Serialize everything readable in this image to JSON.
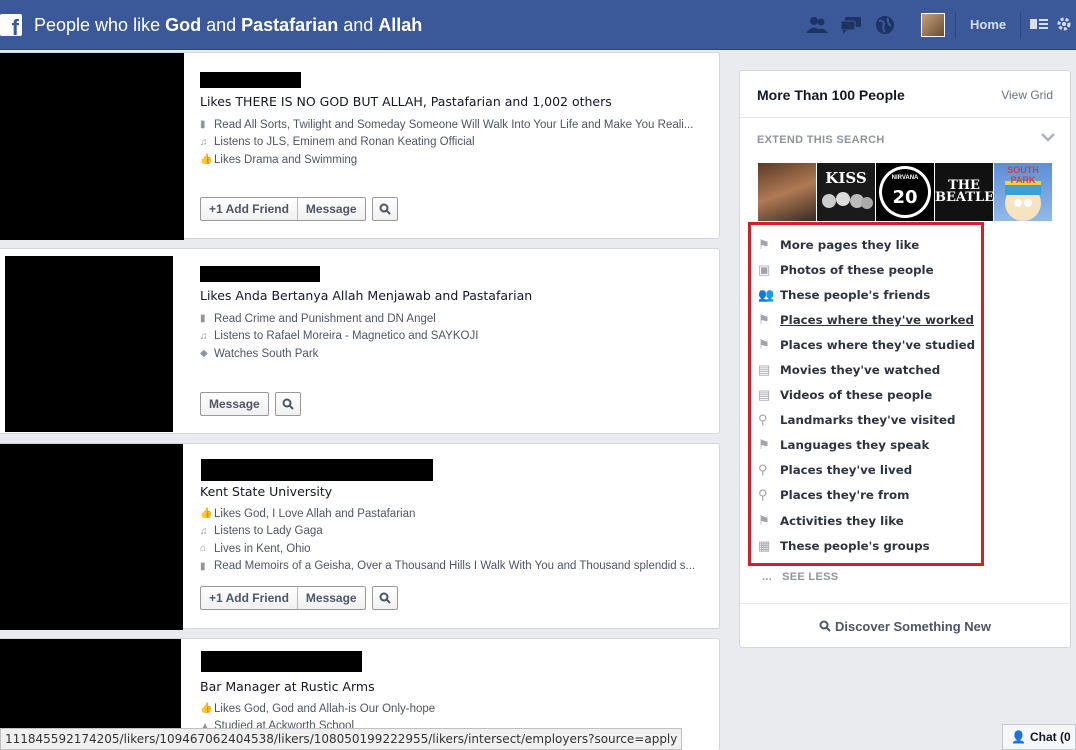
{
  "header": {
    "logo": "f",
    "search_prefix": "People who like ",
    "term1": "God",
    "and1": " and ",
    "term2": "Pastafarian",
    "and2": " and ",
    "term3": "Allah",
    "home": "Home",
    "brand_color": "#3b5998"
  },
  "results": [
    {
      "title": "Likes THERE IS NO GOD BUT ALLAH, Pastafarian and 1,002 others",
      "details": [
        {
          "icon": "book-icon",
          "text": "Read All Sorts, Twilight and Someday Someone Will Walk Into Your Life and Make You Reali..."
        },
        {
          "icon": "music-icon",
          "text": "Listens to JLS, Eminem and Ronan Keating Official"
        },
        {
          "icon": "like-icon",
          "text": "Likes Drama and Swimming"
        }
      ],
      "add_friend": "Add Friend",
      "message": "Message"
    },
    {
      "title": "Likes Anda Bertanya Allah Menjawab and Pastafarian",
      "details": [
        {
          "icon": "book-icon",
          "text": "Read Crime and Punishment and DN Angel"
        },
        {
          "icon": "music-icon",
          "text": "Listens to Rafael Moreira - Magnetico and SAYKOJI"
        },
        {
          "icon": "tag-icon",
          "text": "Watches South Park"
        }
      ],
      "message": "Message"
    },
    {
      "title": "Kent State University",
      "details": [
        {
          "icon": "like-icon",
          "text": "Likes God, I Love Allah and Pastafarian"
        },
        {
          "icon": "music-icon",
          "text": "Listens to Lady Gaga"
        },
        {
          "icon": "home-icon",
          "text": "Lives in Kent, Ohio"
        },
        {
          "icon": "book-icon",
          "text": "Read Memoirs of a Geisha, Over a Thousand Hills I Walk With You and Thousand splendid s..."
        }
      ],
      "add_friend": "Add Friend",
      "message": "Message"
    },
    {
      "title": "Bar Manager at Rustic Arms",
      "details": [
        {
          "icon": "like-icon",
          "text": "Likes God, God and Allah-is Our Only-hope"
        },
        {
          "icon": "graduation-icon",
          "text": "Studied at Ackworth School"
        }
      ]
    }
  ],
  "sidebar": {
    "title": "More Than 100 People",
    "view_grid": "View Grid",
    "extend": "EXTEND THIS SEARCH",
    "thumbs": [
      "",
      "KISS",
      "NIRVANA",
      "THE BEATLES",
      "SOUTH PARK"
    ],
    "items": [
      {
        "icon": "flag-icon",
        "label": "More pages they like"
      },
      {
        "icon": "photo-icon",
        "label": "Photos of these people"
      },
      {
        "icon": "friends-icon",
        "label": "These people's friends"
      },
      {
        "icon": "flag-icon",
        "label": "Places where they've worked"
      },
      {
        "icon": "flag-icon",
        "label": "Places where they've studied"
      },
      {
        "icon": "film-icon",
        "label": "Movies they've watched"
      },
      {
        "icon": "film-icon",
        "label": "Videos of these people"
      },
      {
        "icon": "pin-icon",
        "label": "Landmarks they've visited"
      },
      {
        "icon": "flag-icon",
        "label": "Languages they speak"
      },
      {
        "icon": "pin-icon",
        "label": "Places they've lived"
      },
      {
        "icon": "pin-icon",
        "label": "Places they're from"
      },
      {
        "icon": "flag-icon",
        "label": "Activities they like"
      },
      {
        "icon": "group-icon",
        "label": "These people's groups"
      }
    ],
    "see_less_dots": "...",
    "see_less": "SEE LESS",
    "discover": "Discover Something New",
    "highlight_color": "#d0202a"
  },
  "status_url": "111845592174205/likers/109467062404538/likers/108050199222955/likers/intersect/employers?source=apply",
  "chat": "Chat (0"
}
